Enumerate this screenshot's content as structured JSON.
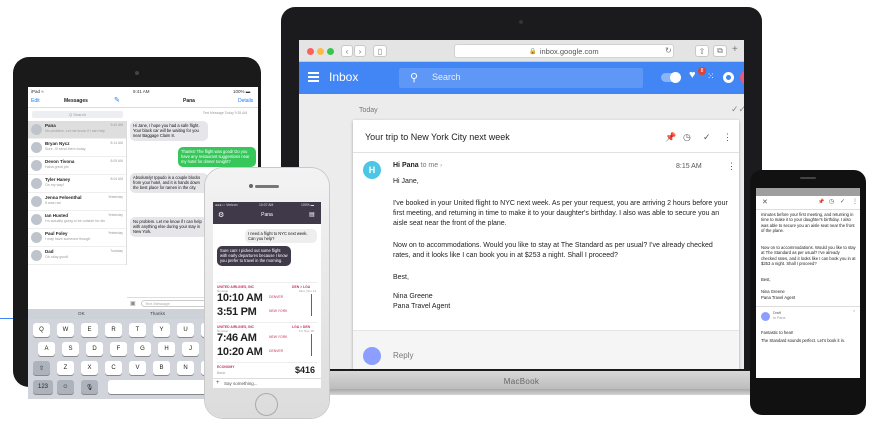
{
  "macbook": {
    "brand": "MacBook",
    "safari": {
      "url": "inbox.google.com",
      "lock_icon": "lock-icon"
    },
    "inbox": {
      "app_title": "Inbox",
      "search_placeholder": "Search",
      "notification_count": "8",
      "section": "Today",
      "email": {
        "subject": "Your trip to New York City next week",
        "avatar_letter": "H",
        "from": "Hi Pana",
        "to": "to me",
        "time": "8:15 AM",
        "greeting": "Hi Jane,",
        "body1": "I've booked in your United flight to NYC next week. As per your request, you are arriving 2 hours before your first meeting, and returning in time to make it to your daughter's birthday. I also was able to secure you an aisle seat near the front of the plane.",
        "body2": "Now on to accommodations. Would you like to stay at The Standard as per usual? I've already checked rates, and it looks like I can book you in at $253 a night. Shall I proceed?",
        "signoff": "Best,",
        "sig_name": "Nina Greene",
        "sig_title": "Pana Travel Agent",
        "reply": "Reply"
      },
      "colors": {
        "header": "#4285f4",
        "avatar": "#4dc6e6"
      }
    }
  },
  "ipad": {
    "status_left": "iPad ≈",
    "status_time": "9:41 AM",
    "status_right": "100% ▬",
    "edit": "Edit",
    "messages_title": "Messages",
    "conv_title": "Pana",
    "details": "Details",
    "search": "Q Search",
    "conversations": [
      {
        "name": "Pana",
        "preview": "No problem. Let me know if I can help with anything else",
        "time": "9:40 AM"
      },
      {
        "name": "Bryan Nycz",
        "preview": "Sure, I'll send them today.",
        "time": "8:14 AM"
      },
      {
        "name": "Devon Tivona",
        "preview": "Haha great job",
        "time": "8:09 AM"
      },
      {
        "name": "Tyler Haney",
        "preview": "On my way!",
        "time": "8:04 AM"
      },
      {
        "name": "Jenna Felsenthal",
        "preview": "It was rad",
        "time": "Yesterday"
      },
      {
        "name": "Ian Husted",
        "preview": "I'm actually going to be outside for dinner soon. Do not",
        "time": "Yesterday"
      },
      {
        "name": "Paul Foley",
        "preview": "I may have someone though",
        "time": "Yesterday"
      },
      {
        "name": "Dad",
        "preview": "Oh okay good!",
        "time": "Tuesday"
      }
    ],
    "thread_meta": "Text Message Today 9:35 AM",
    "thread": [
      {
        "dir": "in",
        "text": "Hi Jane, I hope you had a safe flight. Your black car will be waiting for you near Baggage Claim 8."
      },
      {
        "dir": "out",
        "text": "Thanks! The flight was good! Do you have any restaurant suggestions near my hotel for dinner tonight?"
      },
      {
        "dir": "in",
        "text": "Absolutely! Ippudo is a couple blocks from your hotel, and it is hands down the best place for ramen in the city."
      },
      {
        "dir": "out",
        "text": "Fantastic, thank you!"
      },
      {
        "dir": "in",
        "text": "No problem. Let me know if I can help with anything else during your stay in New York."
      }
    ],
    "compose_placeholder": "Text Message",
    "suggestions": [
      "OK",
      "Thanks",
      "Talk later?"
    ],
    "keyboard_rows": [
      [
        "Q",
        "W",
        "E",
        "R",
        "T",
        "Y",
        "U",
        "I",
        "O"
      ],
      [
        "A",
        "S",
        "D",
        "F",
        "G",
        "H",
        "J",
        "K",
        "L"
      ],
      [
        "⇧",
        "Z",
        "X",
        "C",
        "V",
        "B",
        "N",
        "M",
        "!"
      ],
      [
        "123",
        "☺",
        "🎙"
      ]
    ]
  },
  "iphone": {
    "status_left": "●●●○○ Verizon",
    "status_time": "10:07 AM",
    "status_right": "100% ▬",
    "title": "Pana",
    "msg_user": "I need a flight to NYC next week. Can you help?",
    "msg_agent": "Sure can! I picked out some flight with early departures because I know you prefer to travel in the morning.",
    "flights": [
      {
        "airline": "UNITED AIRLINES, INC",
        "date": "Mon, Nov 14",
        "route": "DEN > LGA",
        "stops": "Nonstop",
        "dep_time": "10:10 AM",
        "dep_code": "DENVER",
        "arr_time": "3:51 PM",
        "arr_code": "NEW YORK"
      },
      {
        "airline": "UNITED AIRLINES, INC",
        "date": "Fri, Nov 18",
        "route": "LGA > DEN",
        "stops": "Nonstop",
        "dep_time": "7:46 AM",
        "dep_code": "NEW YORK",
        "arr_time": "10:20 AM",
        "arr_code": "DENVER"
      }
    ],
    "fare_class": "ECONOMY",
    "fare_note": "Basic",
    "price": "$416",
    "compose": "Say something..."
  },
  "android": {
    "intro": "minutes before your first meeting, and returning in time to make it to your daughter's birthday. I also was able to secure you an aisle seat near the front of the plane.",
    "para2": "Now on to accommodations. Would you like to stay at The Standard as per usual? I've already checked rates, and it looks like I can book you in at $253 a night. Shall I proceed?",
    "signoff": "Best,",
    "sig_name": "Nina Greene",
    "sig_title": "Pana Travel Agent",
    "draft_label": "Draft",
    "draft_to": "to Pana",
    "draft_line1": "Fantastic to hear!",
    "draft_line2": "The Standard sounds perfect. Let's book it in."
  }
}
